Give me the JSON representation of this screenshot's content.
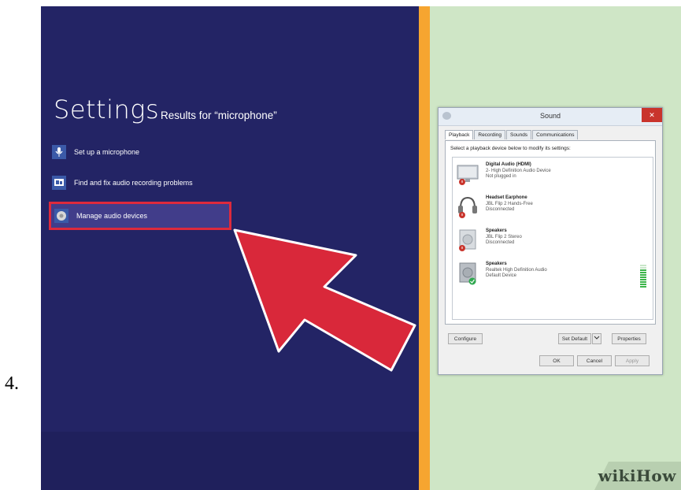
{
  "step_label": "4.",
  "settings": {
    "title": "Settings",
    "results_label": "Results for “microphone”",
    "items": [
      {
        "label": "Set up a microphone",
        "icon": "microphone-icon"
      },
      {
        "label": "Find and fix audio recording problems",
        "icon": "troubleshoot-icon"
      },
      {
        "label": "Manage audio devices",
        "icon": "speaker-icon",
        "highlighted": true
      }
    ]
  },
  "sound_dialog": {
    "title": "Sound",
    "close_glyph": "✕",
    "tabs": [
      "Playback",
      "Recording",
      "Sounds",
      "Communications"
    ],
    "active_tab": "Playback",
    "instruction": "Select a playback device below to modify its settings:",
    "devices": [
      {
        "name": "Digital Audio (HDMI)",
        "line1": "2- High Definition Audio Device",
        "line2": "Not plugged in",
        "status": "unplugged"
      },
      {
        "name": "Headset Earphone",
        "line1": "JBL Flip 2 Hands-Free",
        "line2": "Disconnected",
        "status": "disconnected"
      },
      {
        "name": "Speakers",
        "line1": "JBL Flip 2 Stereo",
        "line2": "Disconnected",
        "status": "disconnected"
      },
      {
        "name": "Speakers",
        "line1": "Realtek High Definition Audio",
        "line2": "Default Device",
        "status": "default"
      }
    ],
    "buttons": {
      "configure": "Configure",
      "set_default": "Set Default",
      "properties": "Properties",
      "ok": "OK",
      "cancel": "Cancel",
      "apply": "Apply"
    }
  },
  "watermark": "wikiHow",
  "colors": {
    "settings_bg": "#232465",
    "divider": "#f6a530",
    "right_bg": "#cfe6c6",
    "highlight_border": "#dd2a3c",
    "arrow": "#d9283a"
  }
}
